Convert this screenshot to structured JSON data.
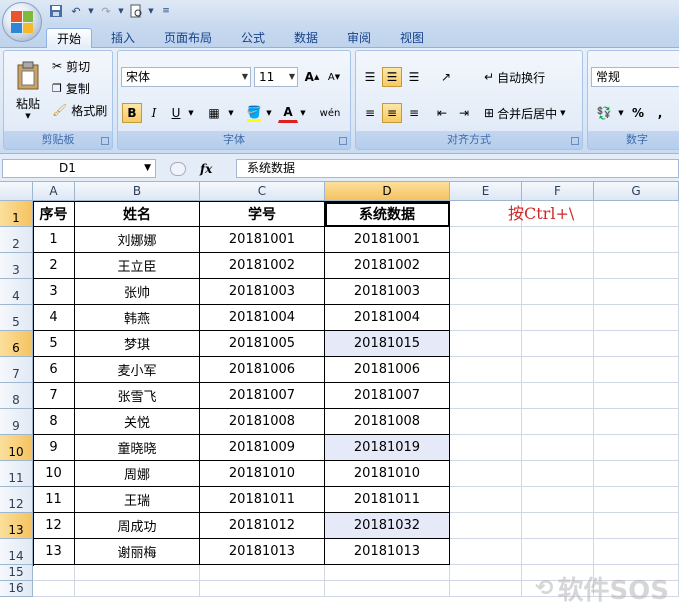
{
  "quick_access": {
    "save_icon": "save-icon",
    "undo_icon": "undo-icon",
    "redo_icon": "redo-icon",
    "preview_icon": "print-preview-icon"
  },
  "tabs": [
    "开始",
    "插入",
    "页面布局",
    "公式",
    "数据",
    "审阅",
    "视图"
  ],
  "ribbon": {
    "clipboard": {
      "paste": "粘贴",
      "cut": "剪切",
      "copy": "复制",
      "format_painter": "格式刷",
      "group": "剪贴板"
    },
    "font": {
      "name": "宋体",
      "size": "11",
      "bold": "B",
      "italic": "I",
      "underline": "U",
      "group": "字体"
    },
    "align": {
      "wrap": "自动换行",
      "merge": "合并后居中",
      "group": "对齐方式"
    },
    "number": {
      "format": "常规",
      "percent": "%",
      "comma": ",",
      "group": "数字"
    }
  },
  "formula_bar": {
    "name_box": "D1",
    "fx": "fx",
    "value": "系统数据"
  },
  "columns": [
    "A",
    "B",
    "C",
    "D",
    "E",
    "F",
    "G"
  ],
  "rows": [
    "1",
    "2",
    "3",
    "4",
    "5",
    "6",
    "7",
    "8",
    "9",
    "10",
    "11",
    "12",
    "13",
    "14",
    "15",
    "16"
  ],
  "table": {
    "headers": [
      "序号",
      "姓名",
      "学号",
      "系统数据"
    ],
    "data": [
      [
        "1",
        "刘娜娜",
        "20181001",
        "20181001"
      ],
      [
        "2",
        "王立臣",
        "20181002",
        "20181002"
      ],
      [
        "3",
        "张帅",
        "20181003",
        "20181003"
      ],
      [
        "4",
        "韩燕",
        "20181004",
        "20181004"
      ],
      [
        "5",
        "梦琪",
        "20181005",
        "20181015"
      ],
      [
        "6",
        "麦小军",
        "20181006",
        "20181006"
      ],
      [
        "7",
        "张雪飞",
        "20181007",
        "20181007"
      ],
      [
        "8",
        "关悦",
        "20181008",
        "20181008"
      ],
      [
        "9",
        "童晓晓",
        "20181009",
        "20181019"
      ],
      [
        "10",
        "周娜",
        "20181010",
        "20181010"
      ],
      [
        "11",
        "王瑞",
        "20181011",
        "20181011"
      ],
      [
        "12",
        "周成功",
        "20181012",
        "20181032"
      ],
      [
        "13",
        "谢丽梅",
        "20181013",
        "20181013"
      ]
    ],
    "highlighted_rows": [
      5,
      9,
      12
    ]
  },
  "note": "按Ctrl+\\",
  "watermark": "软件SOS",
  "colors": {
    "accent": "#15428b",
    "selection": "#f5c35f",
    "note": "#cc2a2a",
    "highlight": "#e6e9f8"
  }
}
